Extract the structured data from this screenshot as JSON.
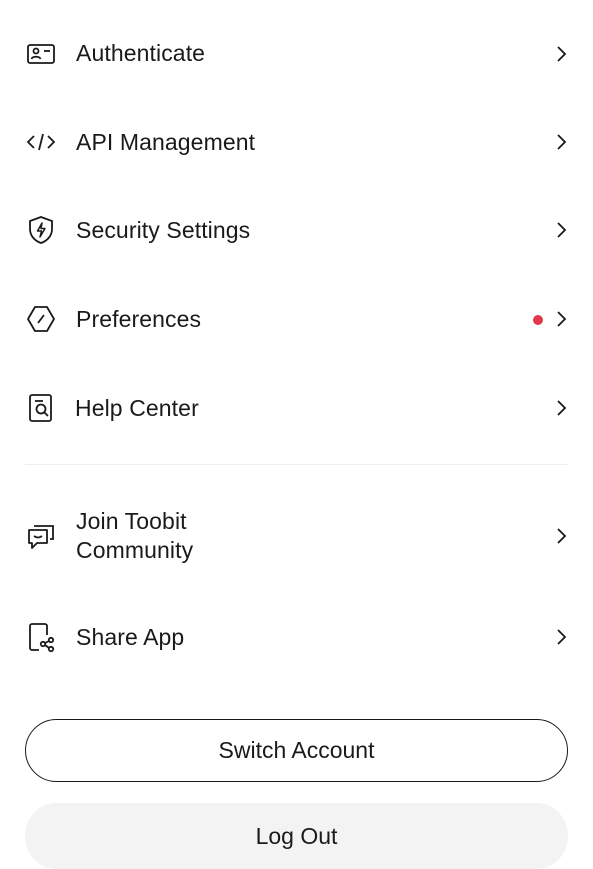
{
  "menu": {
    "items": [
      {
        "label": "Authenticate",
        "icon": "id-card-icon"
      },
      {
        "label": "API Management",
        "icon": "code-icon"
      },
      {
        "label": "Security Settings",
        "icon": "shield-icon"
      },
      {
        "label": "Preferences",
        "icon": "preferences-icon",
        "notification_dot": true
      },
      {
        "label": "Help Center",
        "icon": "help-document-icon"
      },
      {
        "label_line1": "Join Toobit",
        "label_line2": "Community",
        "icon": "chat-bubbles-icon"
      },
      {
        "label": "Share App",
        "icon": "share-app-icon"
      }
    ]
  },
  "buttons": {
    "switch_account": "Switch Account",
    "log_out": "Log Out"
  },
  "colors": {
    "text": "#1a1a1a",
    "notification_dot": "#e0394e",
    "divider": "#ececec",
    "logout_bg": "#f3f3f3"
  }
}
